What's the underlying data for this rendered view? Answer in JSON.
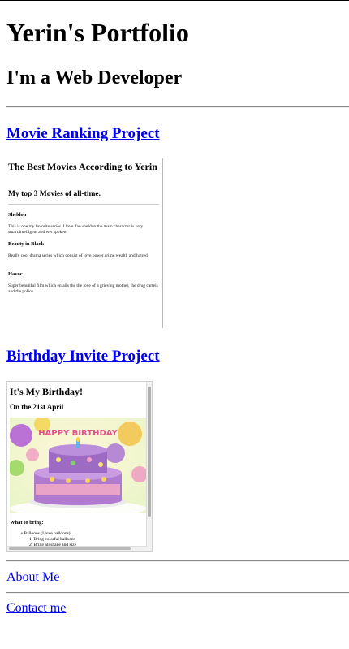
{
  "page": {
    "heading": "Yerin's Portfolio",
    "subheading": "I'm a Web Developer"
  },
  "projects": [
    {
      "title": "Movie Ranking Project"
    },
    {
      "title": "Birthday Invite Project"
    }
  ],
  "movie_preview": {
    "title": "The Best Movies According to Yerin",
    "subtitle": "My top 3 Movies of all-time.",
    "movies": [
      {
        "name": "Sheldon",
        "description": "This is one my favorite series. I love 'fan sheldon the main character is very smart,intelligent and wet spoken"
      },
      {
        "name": "Beauty in Black",
        "description": "Really cool drama series which consist of love,power,crime,wealth and hatred"
      },
      {
        "name": "Havoc",
        "description": "Super beautiful film which entails the the love of a grieving mother, the drug cartels and the police"
      }
    ]
  },
  "birthday_preview": {
    "title": "It's My Birthday!",
    "date": "On the 21st April",
    "cake_text": "HAPPY BIRTHDAY",
    "bring_heading": "What to bring:",
    "bring_item": "Balloons (I love balloons)",
    "steps": [
      "1. Bring colorful balloons",
      "2. Bring all shape and size"
    ]
  },
  "nav": {
    "about": "About Me",
    "contact": "Contact me"
  },
  "colors": {
    "link": "#0000ee",
    "divider": "#888888"
  }
}
